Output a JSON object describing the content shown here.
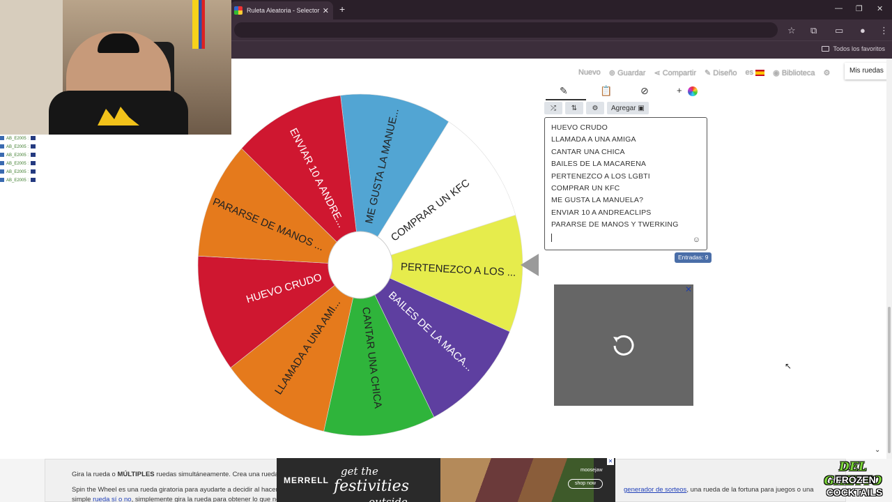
{
  "browser": {
    "tab_title": "Ruleta Aleatoria - Selector Personalizado",
    "tab_close": "✕",
    "new_tab": "+",
    "minimize": "—",
    "restore": "❐",
    "close": "✕",
    "bookmarks_all": "Todos los favoritos"
  },
  "site_nav": {
    "new": "Nuevo",
    "save": "Guardar",
    "share": "Compartir",
    "design": "Diseño",
    "lang": "es",
    "library": "Biblioteca",
    "my_wheels": "Mis ruedas"
  },
  "wheel": {
    "pointer_color": "#9a9a9a",
    "segments": [
      {
        "label": "ME GUSTA LA MANUE...",
        "color": "#52a5d3",
        "text_color": "#222222"
      },
      {
        "label": "COMPRAR UN KFC",
        "color": "#ffffff",
        "text_color": "#222222"
      },
      {
        "label": "PERTENEZCO A LOS ...",
        "color": "#e6ec4c",
        "text_color": "#222222"
      },
      {
        "label": "BAILES DE LA MACA...",
        "color": "#5e3fa0",
        "text_color": "#ffffff"
      },
      {
        "label": "CANTAR UNA CHICA",
        "color": "#2fb43b",
        "text_color": "#222222"
      },
      {
        "label": "LLAMADA A UNA AMI...",
        "color": "#e57a1c",
        "text_color": "#222222"
      },
      {
        "label": "HUEVO CRUDO",
        "color": "#cf1730",
        "text_color": "#ffffff"
      },
      {
        "label": "PARARSE DE MANOS ...",
        "color": "#e57a1c",
        "text_color": "#222222"
      },
      {
        "label": "ENVIAR 10 A ANDRE...",
        "color": "#cf1730",
        "text_color": "#ffffff"
      }
    ]
  },
  "editor": {
    "add_label": "Agregar",
    "entries": [
      "HUEVO CRUDO",
      "LLAMADA A UNA AMIGA",
      "CANTAR UNA CHICA",
      "BAILES DE LA MACARENA",
      "PERTENEZCO A LOS LGBTI",
      "COMPRAR UN KFC",
      "ME GUSTA LA MANUELA?",
      "ENVIAR 10 A ANDREACLIPS",
      "PARARSE DE MANOS Y TWERKING"
    ],
    "entries_count": "Entradas: 9",
    "emoji": "☺"
  },
  "result": {
    "close": "✕"
  },
  "article": {
    "p1_start": "Gira la rueda o ",
    "p1_bold": "MÚLTIPLES",
    "p1_end": " ruedas simultáneamente. Crea una rueda pe",
    "p2_start": "Spin the Wheel es una rueda giratoria para ayudarte a decidir al hacer u",
    "p2_link": "generador de sorteos",
    "p2_end": ", una rueda de la fortuna para juegos o una",
    "p3_start": "simple ",
    "p3_link": "rueda sí o no",
    "p3_end": ", simplemente gira la rueda para obtener lo que nec"
  },
  "ad": {
    "brand": "MERRELL",
    "slogan_1": "get the",
    "slogan_2": "festivities",
    "slogan_3": "outside",
    "store": "moosejaw",
    "shop_now": "shop now",
    "close": "✕"
  },
  "chat": {
    "lines": [
      "AB_E2005 :",
      "AB_E2005 :",
      "AB_E2005 :",
      "AB_E2005 :",
      "AB_E2005 :",
      "AB_E2005 :"
    ]
  },
  "stream_logo": {
    "top": "DEL GHETTO",
    "mid": "FROZEN",
    "bot": "COCKTAILS"
  },
  "scroll_down": "⌄"
}
